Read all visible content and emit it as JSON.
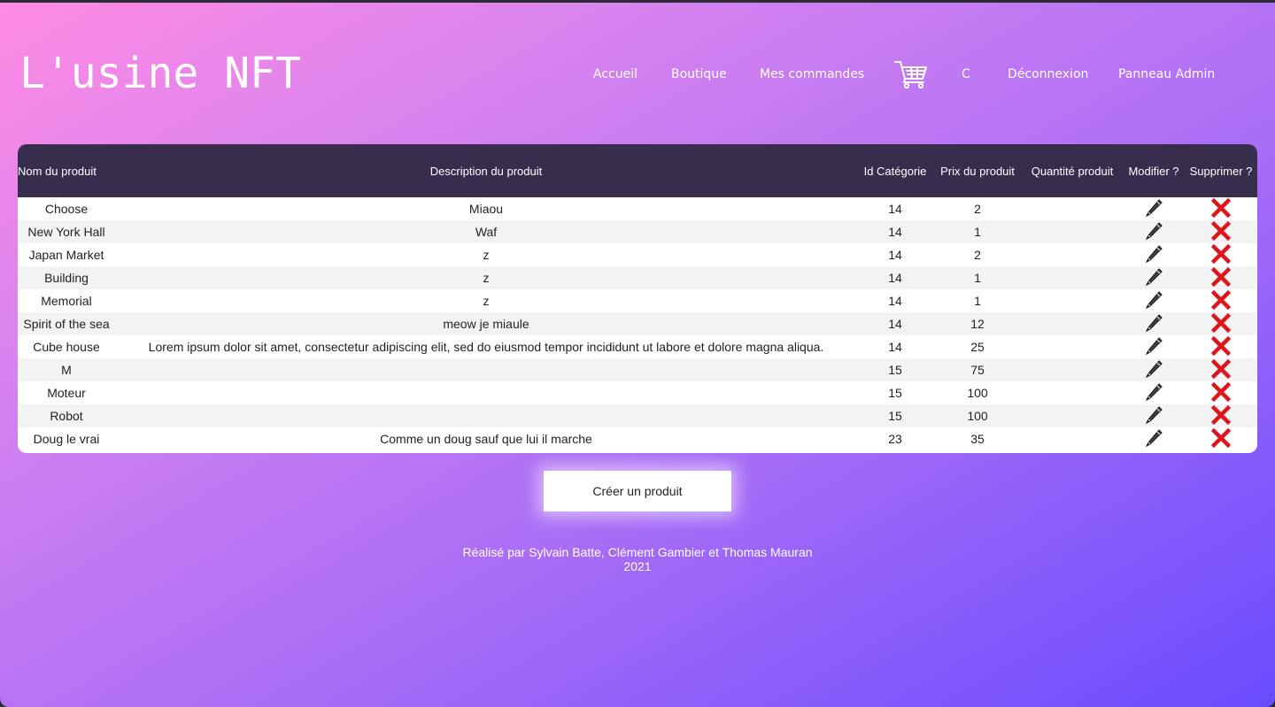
{
  "header": {
    "logo": "L'usine NFT",
    "nav": {
      "accueil": "Accueil",
      "boutique": "Boutique",
      "commandes": "Mes commandes",
      "cart_icon": "shopping-cart-icon",
      "user": "C",
      "deconnexion": "Déconnexion",
      "admin": "Panneau Admin"
    }
  },
  "table": {
    "headers": {
      "name": "Nom du produit",
      "desc": "Description du produit",
      "cat": "Id Catégorie",
      "prix": "Prix du produit",
      "qte": "Quantité produit",
      "mod": "Modifier ?",
      "sup": "Supprimer ?"
    },
    "rows": [
      {
        "name": "Choose",
        "desc": "Miaou",
        "cat": "14",
        "prix": "2",
        "qte": ""
      },
      {
        "name": "New York Hall",
        "desc": "Waf",
        "cat": "14",
        "prix": "1",
        "qte": ""
      },
      {
        "name": "Japan Market",
        "desc": "z",
        "cat": "14",
        "prix": "2",
        "qte": ""
      },
      {
        "name": "Building",
        "desc": "z",
        "cat": "14",
        "prix": "1",
        "qte": ""
      },
      {
        "name": "Memorial",
        "desc": "z",
        "cat": "14",
        "prix": "1",
        "qte": ""
      },
      {
        "name": "Spirit of the sea",
        "desc": "meow je miaule",
        "cat": "14",
        "prix": "12",
        "qte": ""
      },
      {
        "name": "Cube house",
        "desc": "Lorem ipsum dolor sit amet, consectetur adipiscing elit, sed do eiusmod tempor incididunt ut labore et dolore magna aliqua.",
        "cat": "14",
        "prix": "25",
        "qte": ""
      },
      {
        "name": "M",
        "desc": "",
        "cat": "15",
        "prix": "75",
        "qte": ""
      },
      {
        "name": "Moteur",
        "desc": "",
        "cat": "15",
        "prix": "100",
        "qte": ""
      },
      {
        "name": "Robot",
        "desc": "",
        "cat": "15",
        "prix": "100",
        "qte": ""
      },
      {
        "name": "Doug le vrai",
        "desc": "Comme un doug sauf que lui il marche",
        "cat": "23",
        "prix": "35",
        "qte": ""
      }
    ],
    "edit_icon": "pencil-icon",
    "delete_icon": "red-cross-icon",
    "delete_color": "#e0141c"
  },
  "actions": {
    "create": "Créer un produit"
  },
  "footer": {
    "credits": "Réalisé par Sylvain Batte, Clément Gambier et Thomas Mauran",
    "year": "2021"
  },
  "colors": {
    "header_row": "#382d4d",
    "gradient_start": "#ff8be4",
    "gradient_end": "#6a4bff"
  }
}
